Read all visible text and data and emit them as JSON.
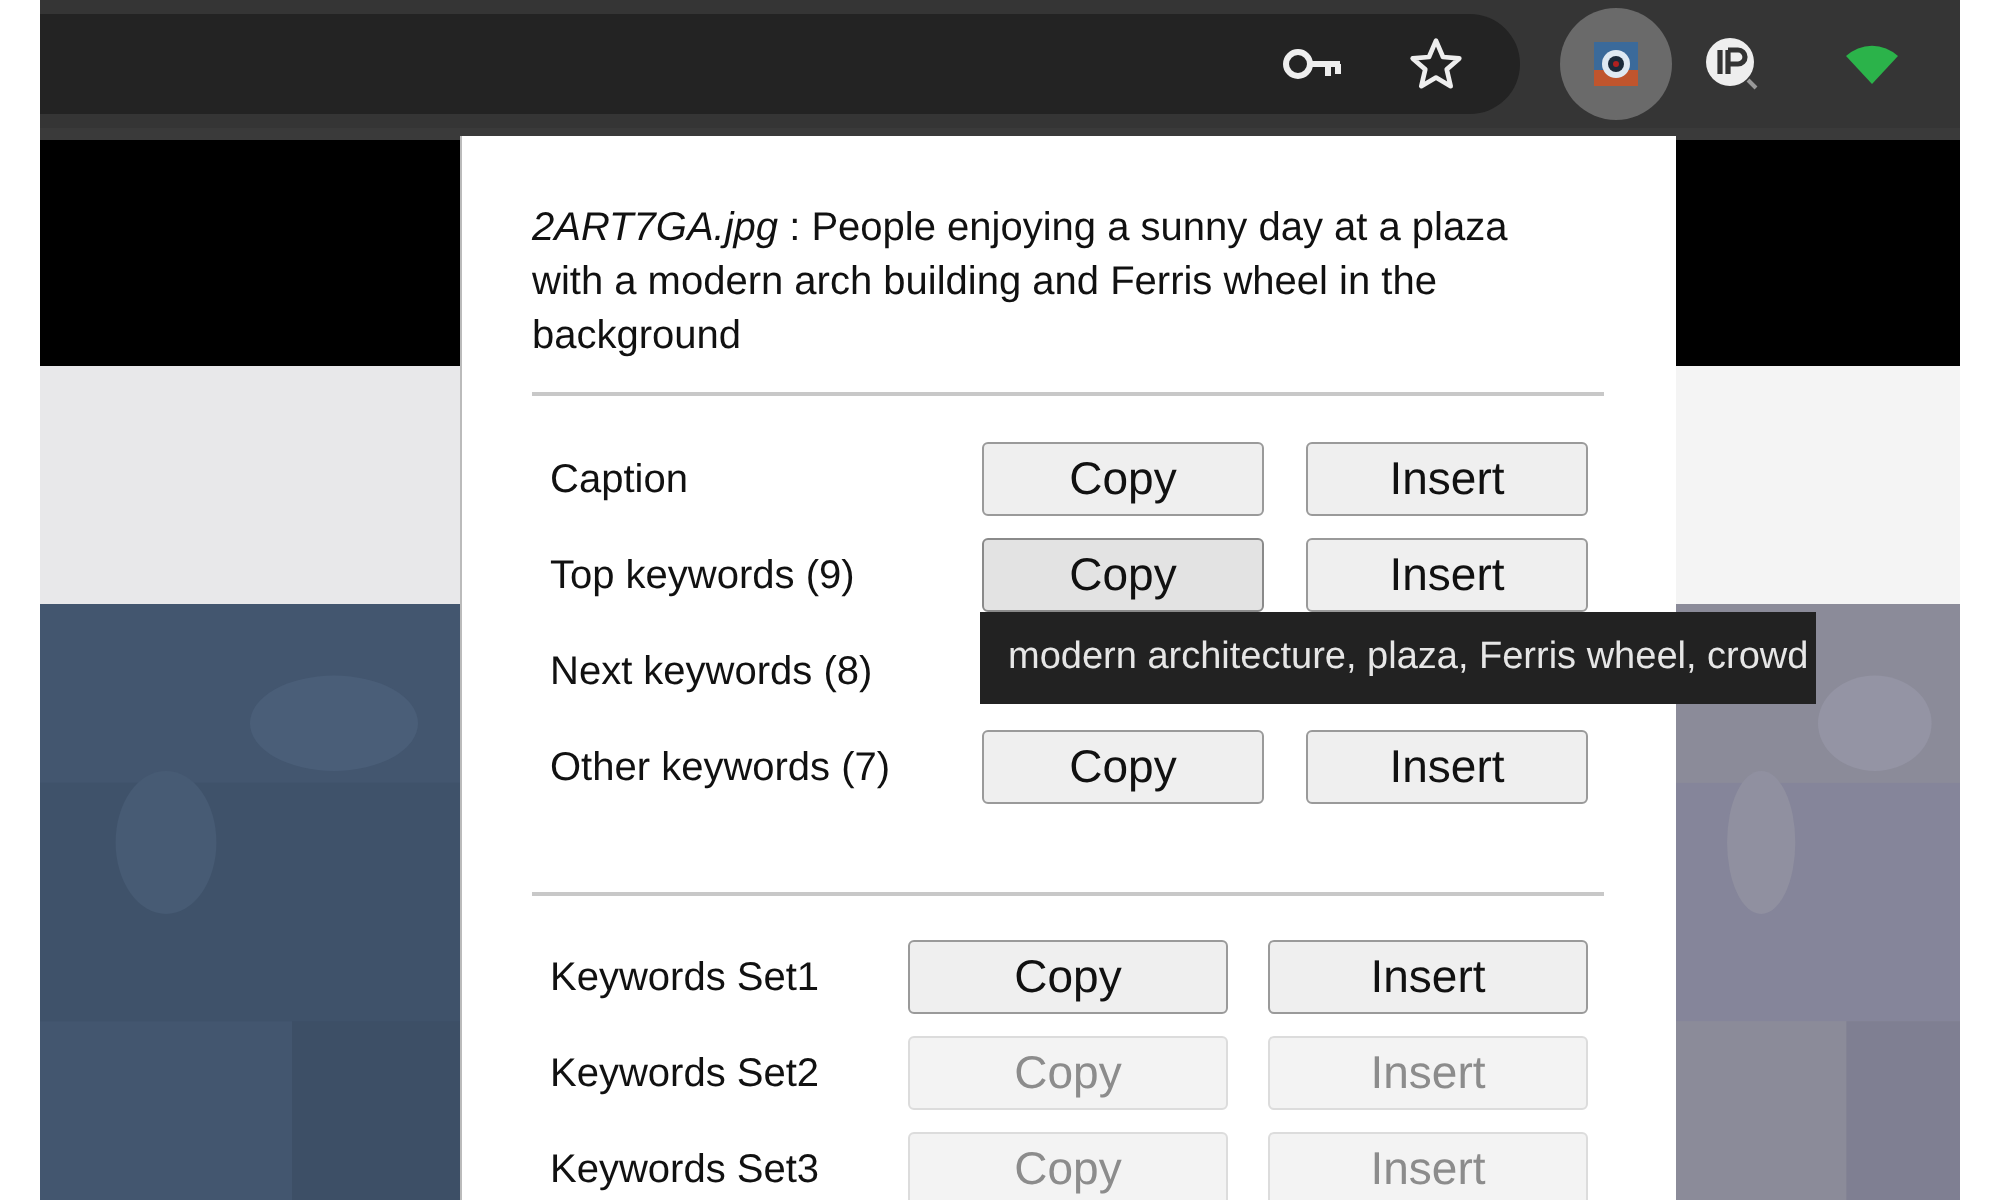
{
  "toolbar": {
    "extension_button": {
      "active": true
    }
  },
  "popup": {
    "description": "*2ART7GA.jpg* : People enjoying a sunny day at a plaza with a modern arch building and Ferris wheel in the background",
    "sections": [
      {
        "kind": "outputs",
        "rows": [
          {
            "label": "Caption",
            "buttons": [
              {
                "label": "Copy",
                "disabled": false,
                "hovered": false
              },
              {
                "label": "Insert",
                "disabled": false,
                "hovered": false
              }
            ]
          },
          {
            "label": "Top keywords (9)",
            "buttons": [
              {
                "label": "Copy",
                "disabled": false,
                "hovered": true
              },
              {
                "label": "Insert",
                "disabled": false,
                "hovered": false
              }
            ]
          },
          {
            "label": "Next keywords (8)"
          },
          {
            "label": "Other keywords (7)",
            "buttons": [
              {
                "label": "Copy",
                "disabled": false,
                "hovered": false
              },
              {
                "label": "Insert",
                "disabled": false,
                "hovered": false
              }
            ]
          }
        ]
      },
      {
        "kind": "sets",
        "rows": [
          {
            "label": "Keywords Set1",
            "buttons": [
              {
                "label": "Copy",
                "disabled": false,
                "hovered": false
              },
              {
                "label": "Insert",
                "disabled": false,
                "hovered": false
              }
            ]
          },
          {
            "label": "Keywords Set2",
            "buttons": [
              {
                "label": "Copy",
                "disabled": true,
                "hovered": false
              },
              {
                "label": "Insert",
                "disabled": true,
                "hovered": false
              }
            ]
          },
          {
            "label": "Keywords Set3",
            "buttons": [
              {
                "label": "Copy",
                "disabled": true,
                "hovered": false
              },
              {
                "label": "Insert",
                "disabled": true,
                "hovered": false
              }
            ]
          }
        ]
      }
    ],
    "tooltip": "modern architecture, plaza, Ferris wheel, crowd"
  }
}
